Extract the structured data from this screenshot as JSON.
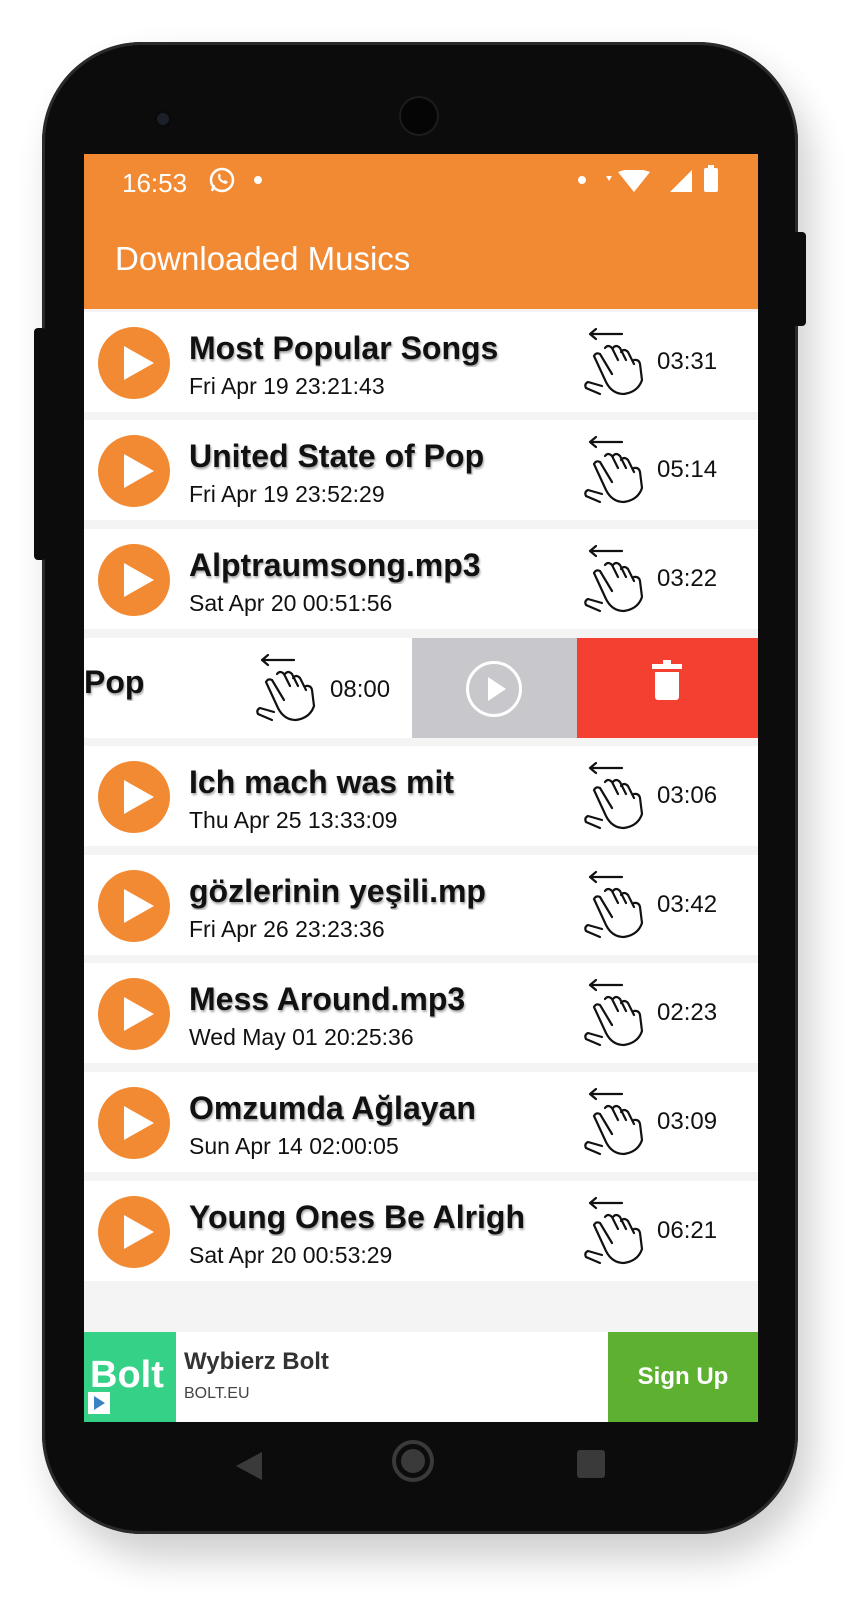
{
  "status_bar": {
    "time": "16:53"
  },
  "app_bar": {
    "title": "Downloaded Musics"
  },
  "songs": [
    {
      "name": "Most Popular Songs",
      "date": "Fri Apr 19 23:21:43",
      "duration": "03:31"
    },
    {
      "name": "United State of Pop",
      "date": "Fri Apr 19 23:52:29",
      "duration": "05:14"
    },
    {
      "name": "Alptraumsong.mp3",
      "date": "Sat Apr 20 00:51:56",
      "duration": "03:22"
    },
    {
      "name": "Pop",
      "date": "",
      "duration": "08:00",
      "swiped": true
    },
    {
      "name": "Ich mach was mit",
      "date": "Thu Apr 25 13:33:09",
      "duration": "03:06"
    },
    {
      "name": "gözlerinin yeşili.mp",
      "date": "Fri Apr 26 23:23:36",
      "duration": "03:42"
    },
    {
      "name": "Mess Around.mp3",
      "date": "Wed May 01 20:25:36",
      "duration": "02:23"
    },
    {
      "name": "Omzumda Ağlayan",
      "date": "Sun Apr 14 02:00:05",
      "duration": "03:09"
    },
    {
      "name": "Young Ones Be Alrigh",
      "date": "Sat Apr 20 00:53:29",
      "duration": "06:21"
    }
  ],
  "ad": {
    "logo_text": "Bolt",
    "title": "Wybierz Bolt",
    "url": "BOLT.EU",
    "cta": "Sign Up"
  },
  "colors": {
    "accent": "#f28a34",
    "delete": "#f44030",
    "swipe_play": "#c8c8cc",
    "ad_cta": "#5eb030",
    "ad_logo": "#34d186"
  }
}
